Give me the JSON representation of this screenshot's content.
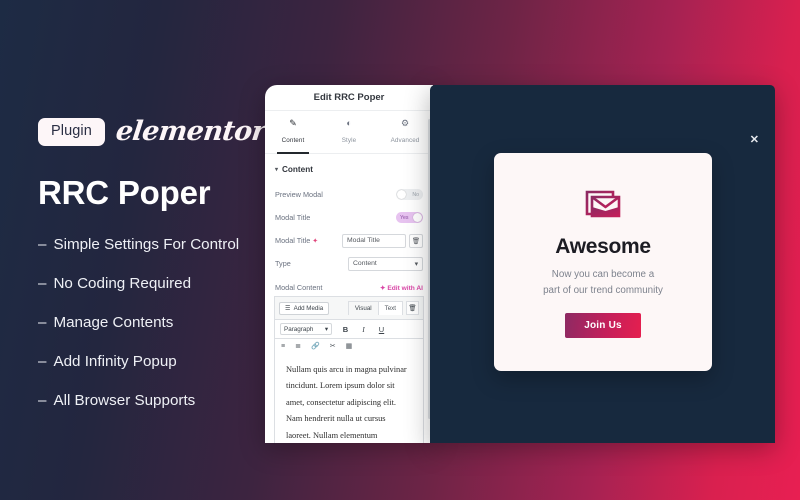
{
  "brand": {
    "plugin_badge": "Plugin",
    "logo_text": "elementor",
    "product_title": "RRC Poper"
  },
  "features": [
    {
      "dash": "–",
      "label": "Simple Settings For Control"
    },
    {
      "dash": "–",
      "label": "No Coding Required"
    },
    {
      "dash": "–",
      "label": "Manage Contents"
    },
    {
      "dash": "–",
      "label": "Add Infinity Popup"
    },
    {
      "dash": "–",
      "label": "All Browser Supports"
    }
  ],
  "editor": {
    "header_title": "Edit RRC Poper",
    "tabs": [
      {
        "label": "Content",
        "icon": "✎"
      },
      {
        "label": "Style",
        "icon": "◐"
      },
      {
        "label": "Advanced",
        "icon": "⚙"
      }
    ],
    "section": {
      "caret": "▾",
      "title": "Content"
    },
    "rows": {
      "preview_modal": {
        "label": "Preview Modal",
        "value": "No"
      },
      "modal_title_toggle": {
        "label": "Modal Title",
        "value": "Yes"
      },
      "modal_title_field": {
        "label": "Modal Title",
        "spark": "✦",
        "value": "Modal Title",
        "trash": "🗑"
      },
      "type": {
        "label": "Type",
        "value": "Content",
        "caret": "▾"
      }
    },
    "modal_content": {
      "label": "Modal Content",
      "edit_with_ai": "✦ Edit with AI",
      "add_media": "Add Media",
      "media_icon": "☰",
      "tab_visual": "Visual",
      "tab_text": "Text",
      "trash_icon": "🗑",
      "format_select": "Paragraph",
      "format_caret": "▾",
      "bold": "B",
      "italic": "I",
      "underline": "U",
      "ul_icon": "≡",
      "ol_icon": "≣",
      "link_icon": "🔗",
      "more_icon": "✂",
      "table_icon": "▦",
      "body_text": "Nullam quis arcu in magna pulvinar tincidunt. Lorem ipsum dolor sit amet, consectetur adipiscing elit. Nam hendrerit nulla ut cursus laoreet. Nullam elementum"
    }
  },
  "preview": {
    "close_icon": "✕",
    "modal": {
      "icon_name": "envelope-icon",
      "heading": "Awesome",
      "subtext_line1": "Now you can become a",
      "subtext_line2": "part of our trend community",
      "cta_label": "Join Us"
    }
  },
  "colors": {
    "accent_pink": "#e51f4f",
    "dark_navy": "#17293e",
    "ai_magenta": "#d946a6",
    "toggle_on": "#e7c3f0"
  }
}
